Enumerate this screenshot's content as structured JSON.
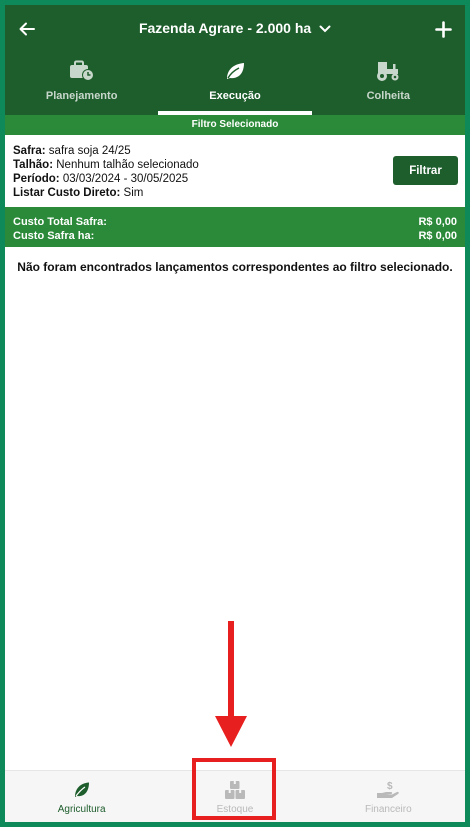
{
  "header": {
    "farm_title": "Fazenda Agrare - 2.000 ha",
    "back_icon": "arrow-left-icon",
    "add_icon": "plus-icon"
  },
  "tabs": [
    {
      "label": "Planejamento",
      "icon": "briefcase-clock-icon",
      "active": false
    },
    {
      "label": "Execução",
      "icon": "leaf-icon",
      "active": true
    },
    {
      "label": "Colheita",
      "icon": "tractor-icon",
      "active": false
    }
  ],
  "filter_bar": {
    "title": "Filtro Selecionado"
  },
  "filter": {
    "safra_label": "Safra:",
    "safra_value": " safra soja 24/25",
    "talhao_label": "Talhão:",
    "talhao_value": " Nenhum talhão selecionado",
    "periodo_label": "Período:",
    "periodo_value": " 03/03/2024 - 30/05/2025",
    "custo_direto_label": "Listar Custo Direto:",
    "custo_direto_value": " Sim",
    "button_label": "Filtrar"
  },
  "costs": {
    "total_label": "Custo Total Safra:",
    "total_value": "R$ 0,00",
    "ha_label": "Custo Safra ha:",
    "ha_value": "R$ 0,00"
  },
  "empty_message": "Não foram encontrados lançamentos correspondentes ao filtro selecionado.",
  "bottom_nav": [
    {
      "label": "Agricultura",
      "icon": "leaf-icon",
      "active": true
    },
    {
      "label": "Estoque",
      "icon": "boxes-icon",
      "active": false
    },
    {
      "label": "Financeiro",
      "icon": "hand-money-icon",
      "active": false
    }
  ],
  "colors": {
    "primary_dark": "#1e5d2c",
    "primary": "#2b8a39",
    "frame": "#0e8a5a",
    "annotation": "#e81f1f"
  }
}
